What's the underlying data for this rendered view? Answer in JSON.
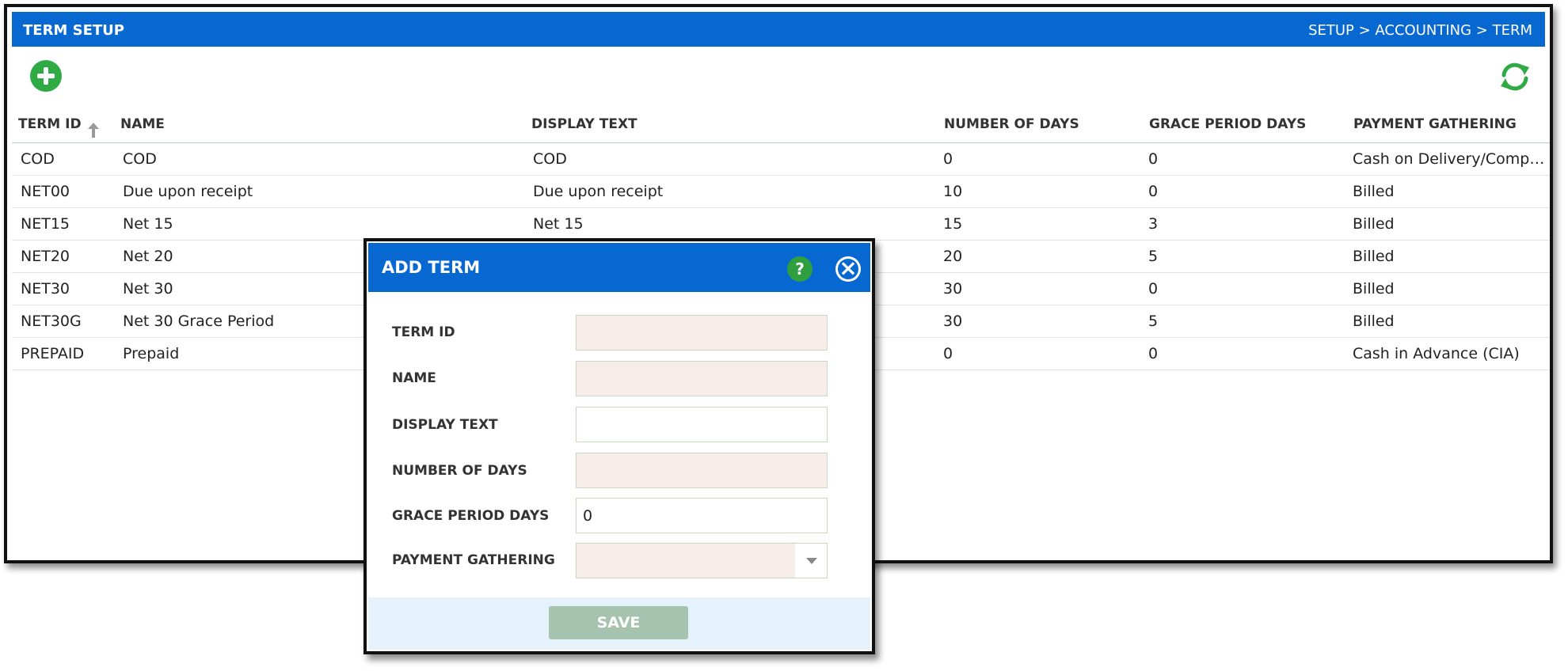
{
  "header": {
    "title": "TERM SETUP",
    "breadcrumb": "SETUP > ACCOUNTING > TERM"
  },
  "toolbar": {
    "add_icon": "plus-circle-icon",
    "refresh_icon": "refresh-icon",
    "accent_color": "#2faa44"
  },
  "table": {
    "columns": [
      "TERM ID",
      "NAME",
      "DISPLAY TEXT",
      "NUMBER OF DAYS",
      "GRACE PERIOD DAYS",
      "PAYMENT GATHERING"
    ],
    "sort_icon": "sort-up-icon",
    "rows": [
      {
        "id": "COD",
        "name": "COD",
        "display": "COD",
        "days": "0",
        "grace": "0",
        "payment": "Cash on Delivery/Compl..."
      },
      {
        "id": "NET00",
        "name": "Due upon receipt",
        "display": "Due upon receipt",
        "days": "10",
        "grace": "0",
        "payment": "Billed"
      },
      {
        "id": "NET15",
        "name": "Net 15",
        "display": "Net 15",
        "days": "15",
        "grace": "3",
        "payment": "Billed"
      },
      {
        "id": "NET20",
        "name": "Net 20",
        "display": "",
        "days": "20",
        "grace": "5",
        "payment": "Billed"
      },
      {
        "id": "NET30",
        "name": "Net 30",
        "display": "",
        "days": "30",
        "grace": "0",
        "payment": "Billed"
      },
      {
        "id": "NET30G",
        "name": "Net 30 Grace Period",
        "display": "",
        "days": "30",
        "grace": "5",
        "payment": "Billed"
      },
      {
        "id": "PREPAID",
        "name": "Prepaid",
        "display": "",
        "days": "0",
        "grace": "0",
        "payment": "Cash in Advance (CIA)"
      }
    ]
  },
  "dialog": {
    "title": "ADD TERM",
    "help_label": "?",
    "help_icon": "help-icon",
    "close_icon": "close-icon",
    "fields": {
      "term_id": {
        "label": "TERM ID",
        "value": ""
      },
      "name": {
        "label": "NAME",
        "value": ""
      },
      "display_text": {
        "label": "DISPLAY TEXT",
        "value": ""
      },
      "number_of_days": {
        "label": "NUMBER OF DAYS",
        "value": ""
      },
      "grace_period_days": {
        "label": "GRACE PERIOD DAYS",
        "value": "0"
      },
      "payment_gathering": {
        "label": "PAYMENT GATHERING",
        "value": ""
      }
    },
    "save_label": "SAVE",
    "primary_color": "#0868d1"
  }
}
